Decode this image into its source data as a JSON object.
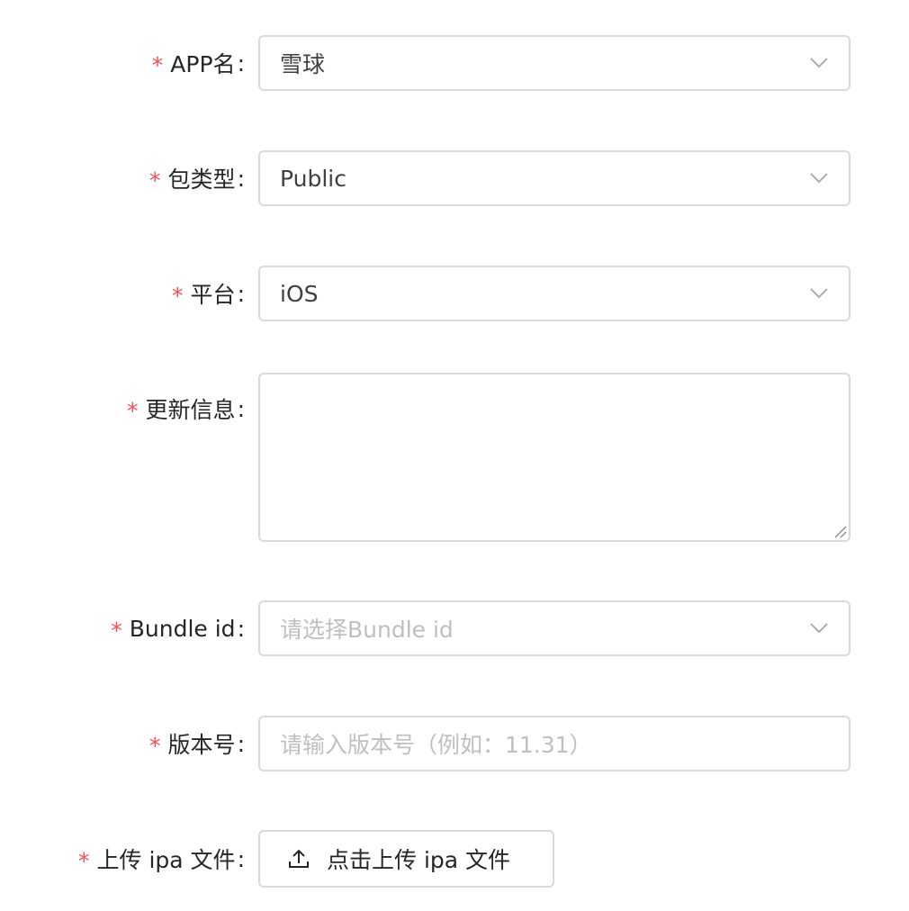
{
  "form": {
    "required_mark": "*",
    "colon": ":",
    "app_name": {
      "label": "APP名",
      "value": "雪球"
    },
    "package_type": {
      "label": "包类型",
      "value": "Public"
    },
    "platform": {
      "label": "平台",
      "value": "iOS"
    },
    "update_info": {
      "label": "更新信息",
      "value": ""
    },
    "bundle_id": {
      "label": "Bundle id",
      "placeholder": "请选择Bundle id"
    },
    "version": {
      "label": "版本号",
      "placeholder": "请输入版本号（例如：11.31）"
    },
    "upload": {
      "label": "上传 ipa 文件",
      "button_label": "点击上传 ipa 文件"
    }
  },
  "icons": {
    "select_arrow": "chevron-down-icon",
    "upload": "upload-icon",
    "resize": "resize-grip-icon"
  },
  "colors": {
    "required": "#ff4d4f",
    "border": "#d9d9d9",
    "placeholder": "#bfbfbf",
    "text": "#262626"
  }
}
